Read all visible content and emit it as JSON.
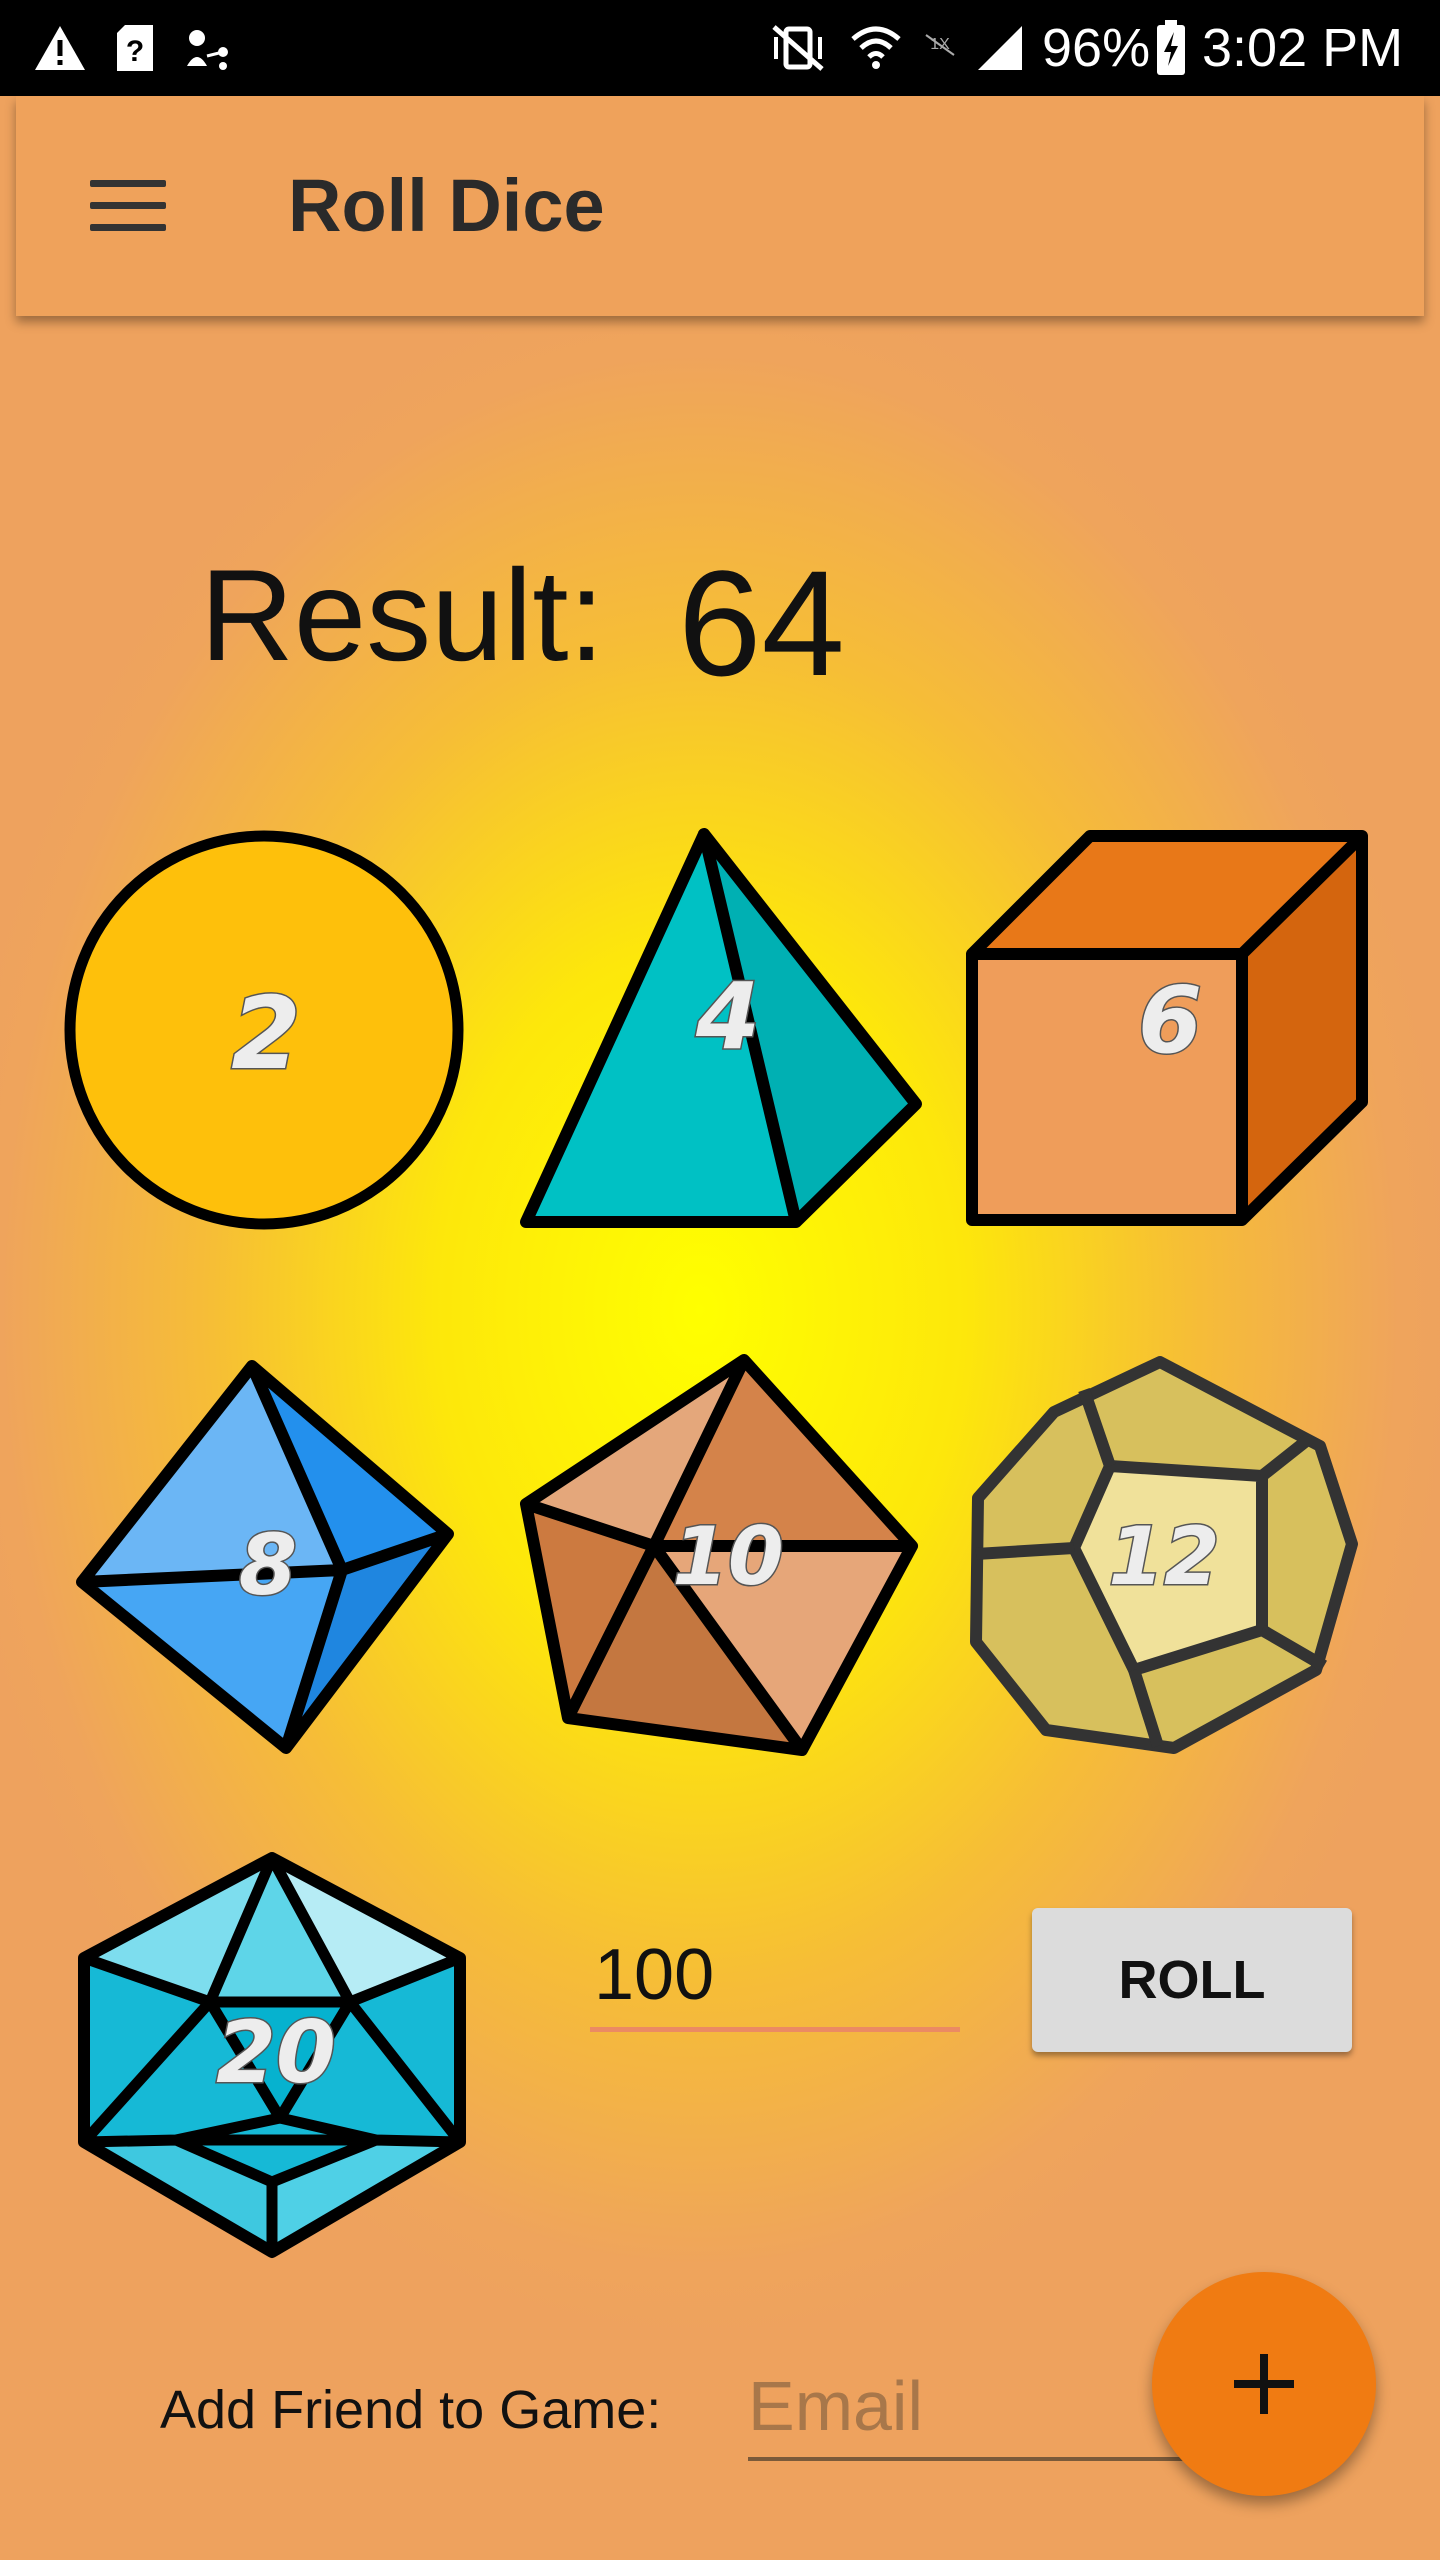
{
  "status_bar": {
    "battery": "96%",
    "time": "3:02 PM",
    "icons": [
      "warning-icon",
      "sim-question-icon",
      "share-icon",
      "vibrate-mute-icon",
      "wifi-icon",
      "no-signal-icon",
      "cell-signal-icon",
      "battery-charging-icon"
    ]
  },
  "app_bar": {
    "title": "Roll Dice",
    "menu_icon": "hamburger-menu-icon"
  },
  "result": {
    "label": "Result:",
    "value": "64"
  },
  "dice": {
    "d2": "2",
    "d4": "4",
    "d6": "6",
    "d8": "8",
    "d10": "10",
    "d12": "12",
    "d20": "20"
  },
  "roll_input": {
    "value": "100"
  },
  "roll_button": {
    "label": "ROLL"
  },
  "add_friend": {
    "label": "Add Friend to Game:",
    "placeholder": "Email"
  },
  "fab": {
    "icon": "plus-icon"
  },
  "colors": {
    "app_bar": "#efa25b",
    "fab": "#f07b12",
    "center_glow": "#ffff00",
    "input_underline": "#eb8a63"
  }
}
